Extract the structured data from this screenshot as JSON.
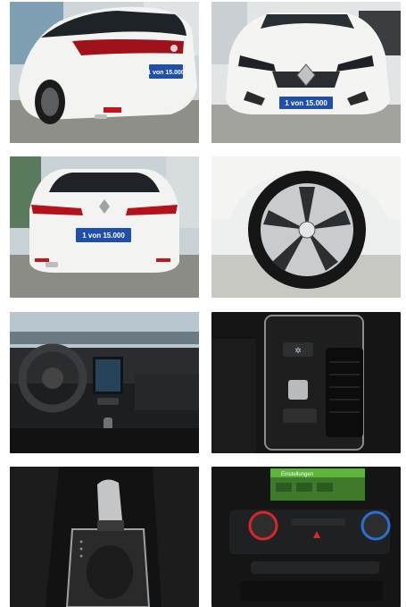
{
  "gallery": {
    "photos": [
      {
        "name": "photo-rear-three-quarter",
        "plate": "1 von 15.000"
      },
      {
        "name": "photo-front",
        "plate": "1 von 15.000"
      },
      {
        "name": "photo-rear",
        "plate": "1 von 15.000"
      },
      {
        "name": "photo-wheel"
      },
      {
        "name": "photo-dashboard"
      },
      {
        "name": "photo-center-console"
      },
      {
        "name": "photo-gear-selector"
      },
      {
        "name": "photo-infotainment",
        "screen_title": "Einstellungen"
      }
    ]
  },
  "colors": {
    "car_white": "#f2f3f1",
    "plate_blue": "#1f4fa8",
    "taillight_red": "#b3121b",
    "showroom_floor": "#9a9a95",
    "interior_black": "#161616"
  }
}
